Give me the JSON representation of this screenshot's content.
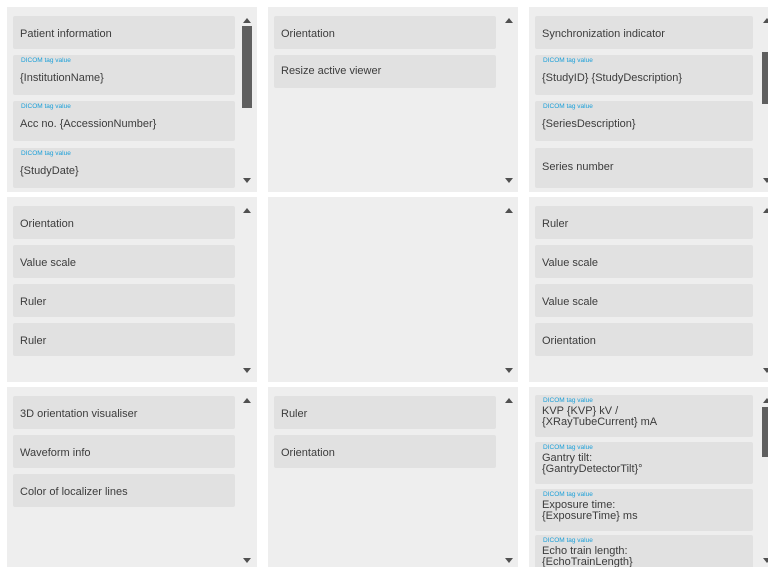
{
  "tag_caption": "DICOM tag value",
  "row1": {
    "col1": {
      "patient_information": "Patient information",
      "institution_name": "{InstitutionName}",
      "accession": "Acc no. {AccessionNumber}",
      "study_date": "{StudyDate}"
    },
    "col2": {
      "orientation": "Orientation",
      "resize_active_viewer": "Resize active viewer"
    },
    "col3": {
      "synchronization_indicator": "Synchronization indicator",
      "study": "{StudyID} {StudyDescription}",
      "series_description": "{SeriesDescription}",
      "series_number": "Series number"
    }
  },
  "row2": {
    "col1": {
      "orientation": "Orientation",
      "value_scale": "Value scale",
      "ruler_1": "Ruler",
      "ruler_2": "Ruler"
    },
    "col3": {
      "ruler": "Ruler",
      "value_scale_1": "Value scale",
      "value_scale_2": "Value scale",
      "orientation": "Orientation"
    }
  },
  "row3": {
    "col1": {
      "orientation_visualiser": "3D orientation visualiser",
      "waveform_info": "Waveform info",
      "localizer_color": "Color of localizer lines"
    },
    "col2": {
      "ruler": "Ruler",
      "orientation": "Orientation"
    },
    "col3": {
      "kvp_line1": "KVP {KVP} kV /",
      "kvp_line2": "{XRayTubeCurrent} mA",
      "gantry_line1": "Gantry tilt:",
      "gantry_line2": "{GantryDetectorTilt}°",
      "exposure_line1": "Exposure time:",
      "exposure_line2": "{ExposureTime} ms",
      "echo_line1": "Echo train length:",
      "echo_line2": "{EchoTrainLength}"
    }
  }
}
